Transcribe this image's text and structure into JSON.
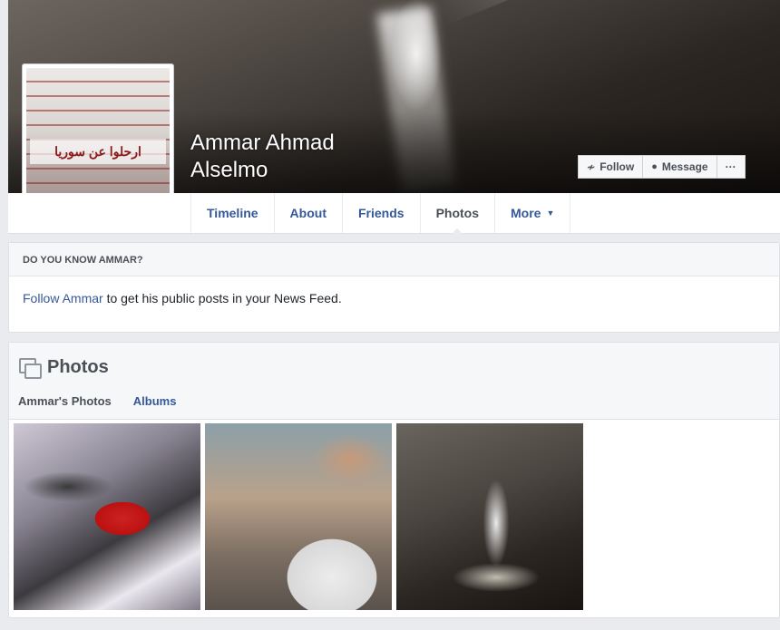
{
  "profile": {
    "name_line1": "Ammar Ahmad",
    "name_line2": "Alselmo",
    "avatar_script": "ارحلوا عن سوريا"
  },
  "actions": {
    "follow": "Follow",
    "message": "Message",
    "more": "···"
  },
  "nav": {
    "tabs": [
      {
        "label": "Timeline"
      },
      {
        "label": "About"
      },
      {
        "label": "Friends"
      },
      {
        "label": "Photos"
      },
      {
        "label": "More"
      }
    ]
  },
  "know": {
    "heading": "DO YOU KNOW AMMAR?",
    "link": "Follow Ammar",
    "text": " to get his public posts in your News Feed."
  },
  "photos": {
    "title": "Photos",
    "tabs": [
      "Ammar's Photos",
      "Albums"
    ]
  }
}
